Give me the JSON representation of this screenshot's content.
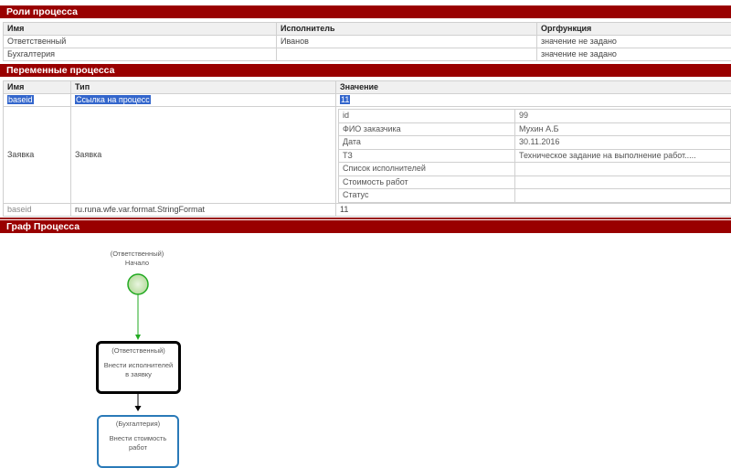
{
  "roles": {
    "title": "Роли процесса",
    "columns": [
      "Имя",
      "Исполнитель",
      "Оргфункция"
    ],
    "rows": [
      [
        "Ответственный",
        "Иванов",
        "значение не задано"
      ],
      [
        "Бухгалтерия",
        "",
        "значение не задано"
      ]
    ]
  },
  "variables": {
    "title": "Переменные процесса",
    "columns": [
      "Имя",
      "Тип",
      "Значение"
    ],
    "row1": {
      "name": "baseid",
      "type": "Ссылка на процесс",
      "value": "11"
    },
    "row2": {
      "name": "Заявка",
      "type": "Заявка",
      "fields": [
        [
          "id",
          "99"
        ],
        [
          "ФИО заказчика",
          "Мухин А.Б"
        ],
        [
          "Дата",
          "30.11.2016"
        ],
        [
          "ТЗ",
          "Техническое задание на выполнение работ....."
        ],
        [
          "Список исполнителей",
          ""
        ],
        [
          "Стоимость работ",
          ""
        ],
        [
          "Статус",
          ""
        ]
      ]
    },
    "row3": {
      "name": "baseid",
      "type": "ru.runa.wfe.var.format.StringFormat",
      "value": "11"
    }
  },
  "graph": {
    "title": "Граф Процесса",
    "start": {
      "role": "(Ответственный)",
      "name": "Начало"
    },
    "task1": {
      "role": "(Ответственный)",
      "name": "Внести исполнителей в заявку"
    },
    "task2": {
      "role": "(Бухгалтерия)",
      "name": "Внести стоимость работ"
    }
  },
  "colors": {
    "header": "#990000",
    "selection": "#3366cc",
    "start": "#22aa22",
    "task_active": "#000000",
    "task_next": "#2a7ab8"
  }
}
